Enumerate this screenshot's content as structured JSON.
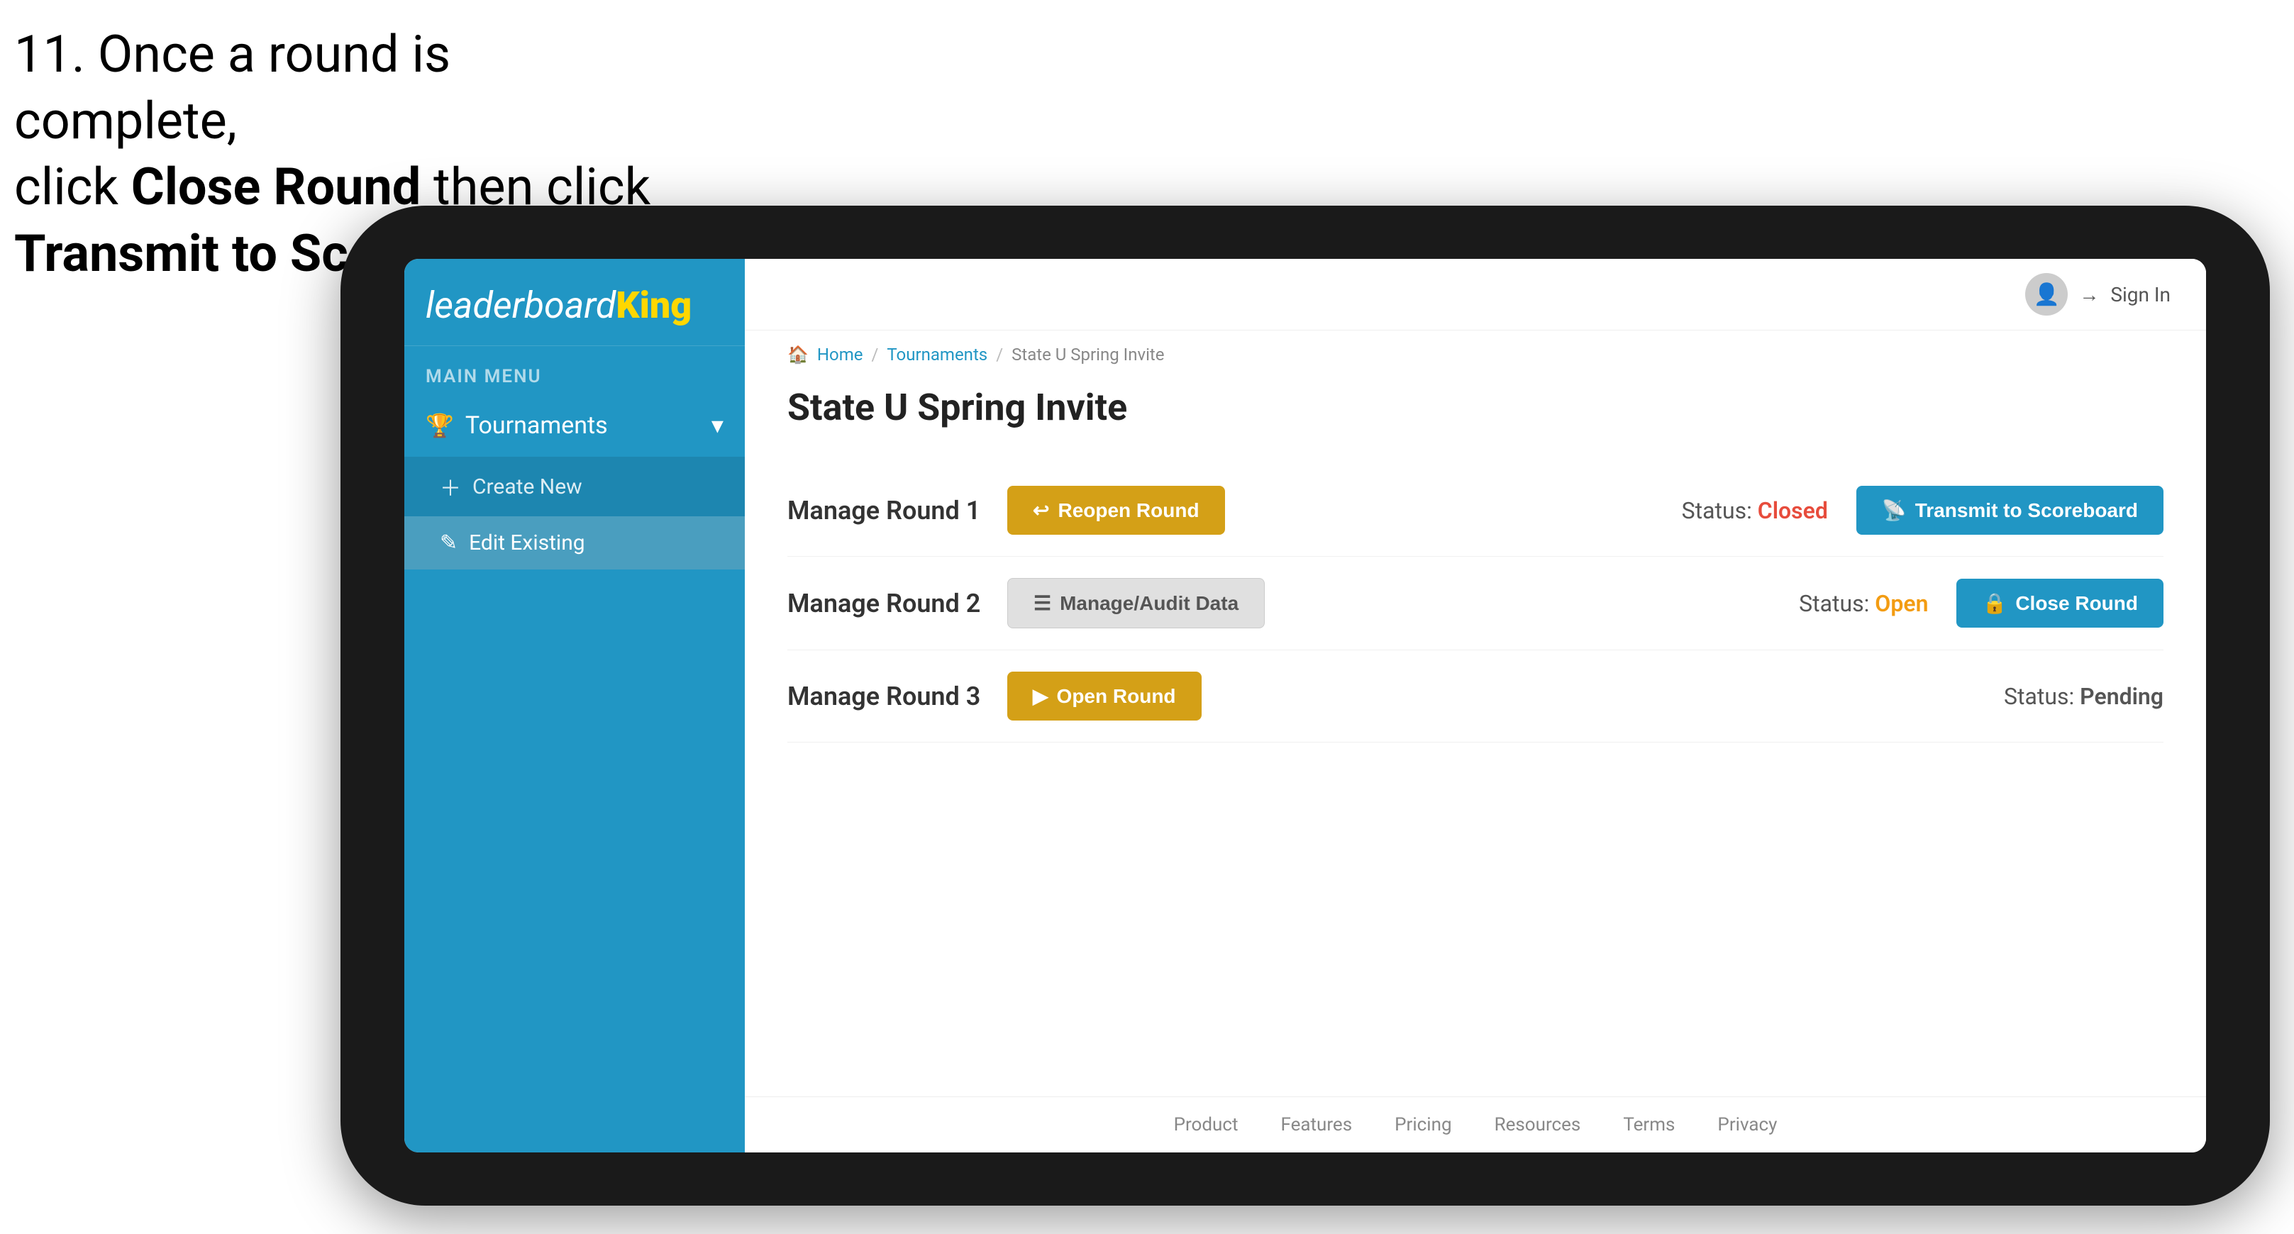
{
  "instruction": {
    "line1": "11. Once a round is complete,",
    "line2_prefix": "click ",
    "line2_bold": "Close Round",
    "line2_suffix": " then click",
    "line3": "Transmit to Scoreboard."
  },
  "logo": {
    "text_regular": "leaderboard",
    "text_bold": "King"
  },
  "sidebar": {
    "main_menu_label": "MAIN MENU",
    "nav_items": [
      {
        "label": "Tournaments",
        "icon": "🏆",
        "expanded": true
      }
    ],
    "sub_items": [
      {
        "label": "Create New",
        "icon": "+"
      },
      {
        "label": "Edit Existing",
        "icon": "✎",
        "active": true
      }
    ]
  },
  "topbar": {
    "sign_in_label": "Sign In"
  },
  "breadcrumb": {
    "home": "Home",
    "tournaments": "Tournaments",
    "current": "State U Spring Invite"
  },
  "page": {
    "title": "State U Spring Invite",
    "rounds": [
      {
        "title": "Manage Round 1",
        "status_label": "Status:",
        "status_value": "Closed",
        "status_color": "closed",
        "buttons": [
          {
            "label": "Reopen Round",
            "type": "gold",
            "icon": "↩"
          },
          {
            "label": "Transmit to Scoreboard",
            "type": "blue",
            "icon": "📡"
          }
        ]
      },
      {
        "title": "Manage Round 2",
        "status_label": "Status:",
        "status_value": "Open",
        "status_color": "open",
        "buttons": [
          {
            "label": "Manage/Audit Data",
            "type": "gray",
            "icon": "☰"
          },
          {
            "label": "Close Round",
            "type": "blue",
            "icon": "🔒"
          }
        ]
      },
      {
        "title": "Manage Round 3",
        "status_label": "Status:",
        "status_value": "Pending",
        "status_color": "pending",
        "buttons": [
          {
            "label": "Open Round",
            "type": "gold",
            "icon": "▶"
          }
        ]
      }
    ]
  },
  "footer": {
    "links": [
      "Product",
      "Features",
      "Pricing",
      "Resources",
      "Terms",
      "Privacy"
    ]
  }
}
